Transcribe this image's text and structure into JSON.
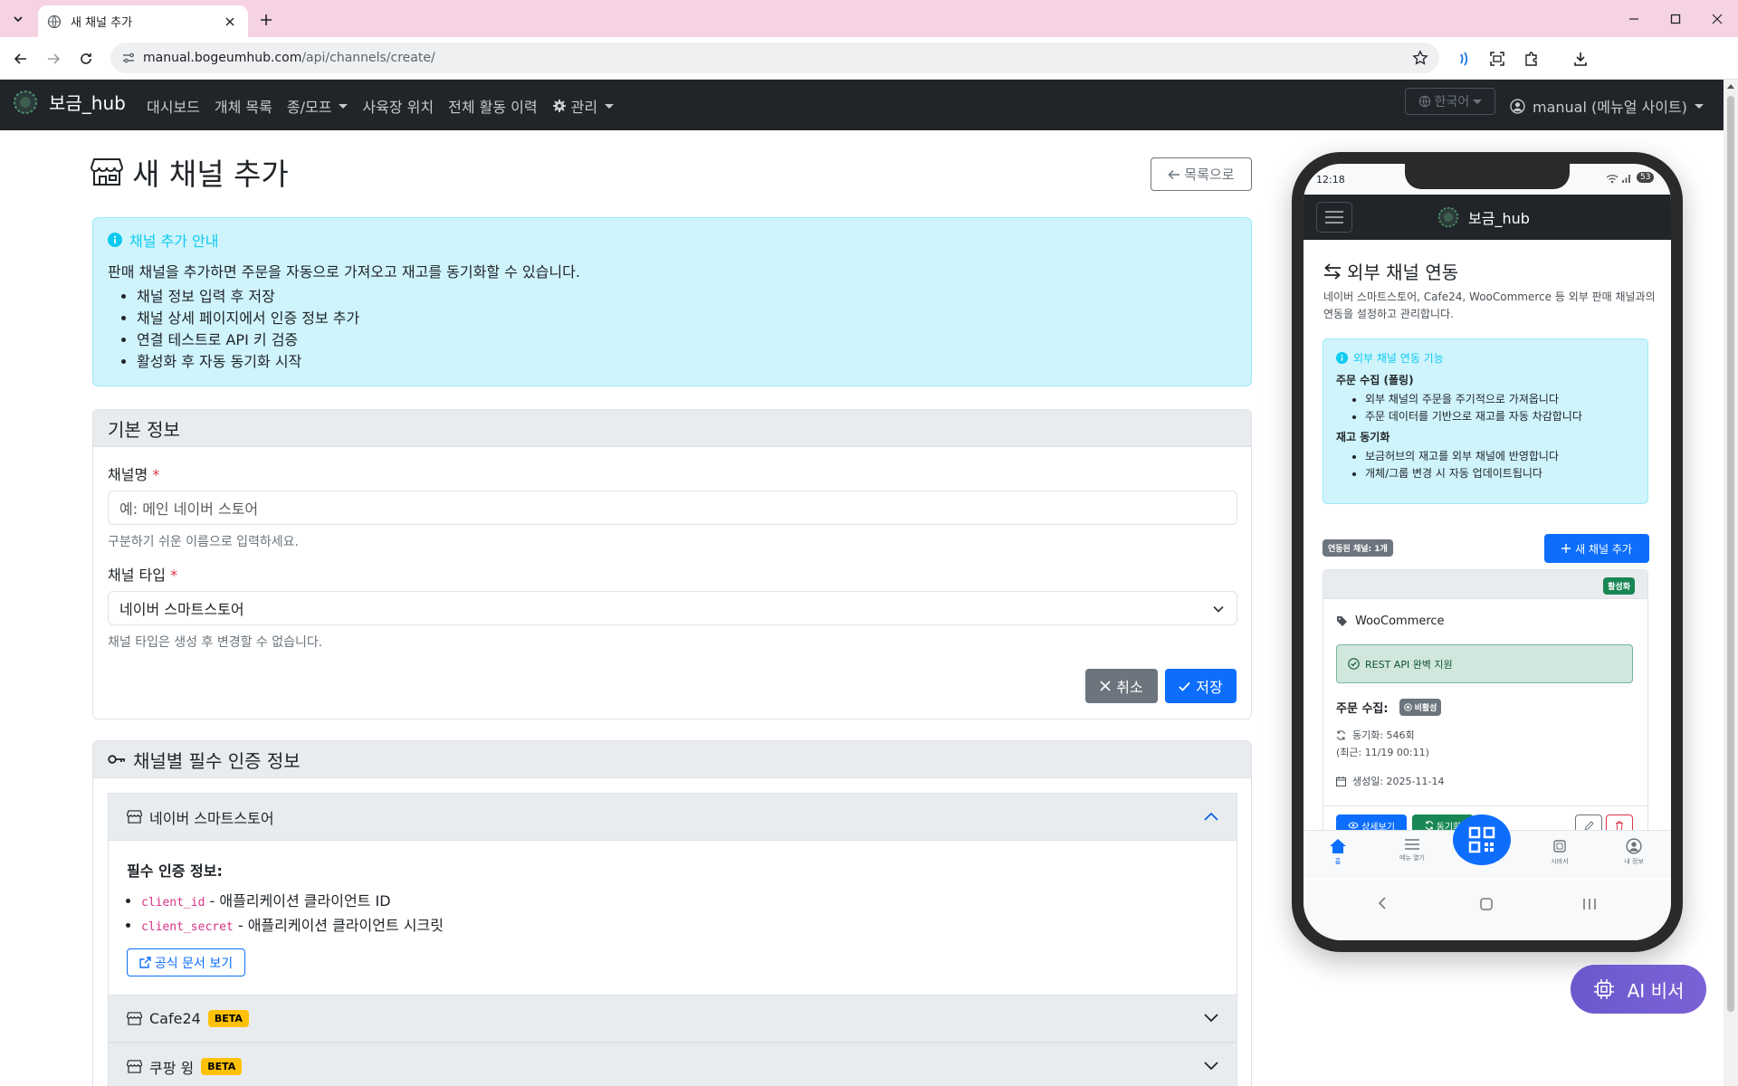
{
  "browser": {
    "tab_title": "새 채널 추가",
    "url_host": "manual.bogeumhub.com",
    "url_path": "/api/channels/create/"
  },
  "navbar": {
    "brand": "보금_hub",
    "links": [
      "대시보드",
      "개체 목록",
      "종/모프",
      "사육장 위치",
      "전체 활동 이력",
      "관리"
    ],
    "lang": "한국어",
    "user": "manual (메뉴얼 사이트)"
  },
  "page": {
    "title": "새 채널 추가",
    "back_button": "목록으로"
  },
  "guide": {
    "title": "채널 추가 안내",
    "desc": "판매 채널을 추가하면 주문을 자동으로 가져오고 재고를 동기화할 수 있습니다.",
    "items": [
      "채널 정보 입력 후 저장",
      "채널 상세 페이지에서 인증 정보 추가",
      "연결 테스트로 API 키 검증",
      "활성화 후 자동 동기화 시작"
    ]
  },
  "basic": {
    "header": "기본 정보",
    "name_label": "채널명",
    "name_placeholder": "예: 메인 네이버 스토어",
    "name_help": "구분하기 쉬운 이름으로 입력하세요.",
    "type_label": "채널 타입",
    "type_value": "네이버 스마트스토어",
    "type_help": "채널 타입은 생성 후 변경할 수 없습니다.",
    "cancel": "취소",
    "save": "저장"
  },
  "auth": {
    "header": "채널별 필수 인증 정보",
    "naver": {
      "title": "네이버 스마트스토어",
      "req_title": "필수 인증 정보:",
      "items": [
        {
          "code": "client_id",
          "desc": " - 애플리케이션 클라이언트 ID"
        },
        {
          "code": "client_secret",
          "desc": " - 애플리케이션 클라이언트 시크릿"
        }
      ],
      "doc_button": "공식 문서 보기"
    },
    "cafe24": {
      "title": "Cafe24",
      "badge": "BETA"
    },
    "coupang": {
      "title": "쿠팡 윙",
      "badge": "BETA"
    }
  },
  "phone": {
    "time": "12:18",
    "battery": "53",
    "brand": "보금_hub",
    "title": "외부 채널 연동",
    "desc": "네이버 스마트스토어, Cafe24, WooCommerce 등 외부 판매 채널과의 연동을 설정하고 관리합니다.",
    "alert_title": "외부 채널 연동 기능",
    "sec1_title": "주문 수집 (폴링)",
    "sec1_items": [
      "외부 채널의 주문을 주기적으로 가져옵니다",
      "주문 데이터를 기반으로 재고를 자동 차감합니다"
    ],
    "sec2_title": "재고 동기화",
    "sec2_items": [
      "보금허브의 재고를 외부 채널에 반영합니다",
      "개체/그룹 변경 시 자동 업데이트됩니다"
    ],
    "connected_badge": "연동된 채널: 1개",
    "add_button": "새 채널 추가",
    "card": {
      "status": "활성화",
      "name": "WooCommerce",
      "api_box": "REST API 완벽 지원",
      "order_label": "주문 수집:",
      "order_status": "비활성",
      "sync_count": "동기화: 546회",
      "sync_recent": "(최근: 11/19 00:11)",
      "created": "생성일: 2025-11-14",
      "detail_btn": "상세보기",
      "sync_btn": "동기화"
    },
    "bottom_nav": [
      "홈",
      "메뉴 열기",
      "",
      "시바서",
      "내 정보"
    ]
  },
  "ai_button": "AI 비서",
  "colors": {
    "primary": "#0d6efd",
    "navbar": "#212529",
    "info_bg": "#cff4fc",
    "secondary": "#6c757d",
    "tabbar": "#f5d3e3"
  }
}
